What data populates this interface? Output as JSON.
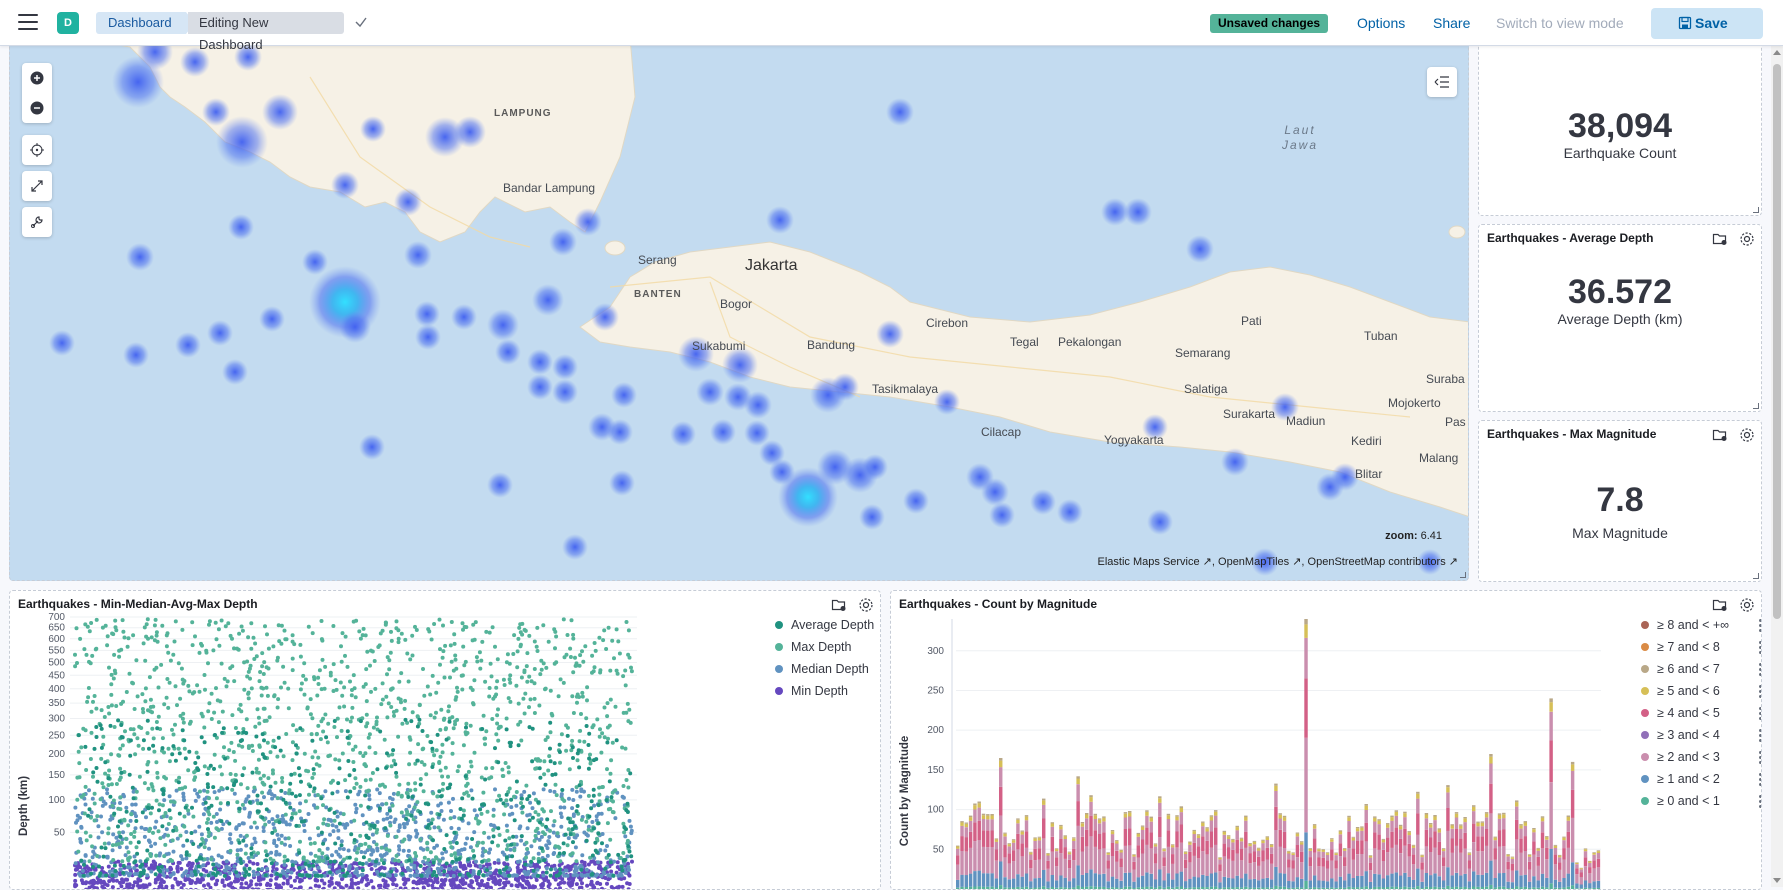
{
  "header": {
    "space_initial": "D",
    "breadcrumbs": [
      "Dashboard",
      "Editing New Dashboard"
    ],
    "unsaved_badge": "Unsaved changes",
    "options": "Options",
    "share": "Share",
    "switch_view": "Switch to view mode",
    "save": "Save"
  },
  "map": {
    "zoom_label": "zoom:",
    "zoom_value": "6.41",
    "attribution": [
      "Elastic Maps Service",
      "OpenMapTiles",
      "OpenStreetMap contributors"
    ],
    "labels": {
      "lampung": "LAMPUNG",
      "bandar_lampung": "Bandar Lampung",
      "laut_jawa": "Laut\nJawa",
      "serang": "Serang",
      "jakarta": "Jakarta",
      "banten": "BANTEN",
      "bogor": "Bogor",
      "cirebon": "Cirebon",
      "tegal": "Tegal",
      "pekalongan": "Pekalongan",
      "semarang": "Semarang",
      "pati": "Pati",
      "tuban": "Tuban",
      "surabaya": "Suraba",
      "sukabumi": "Sukabumi",
      "bandung": "Bandung",
      "tasikmalaya": "Tasikmalaya",
      "salatiga": "Salatiga",
      "mojokerto": "Mojokerto",
      "surakarta": "Surakarta",
      "madiun": "Madiun",
      "pasuruan": "Pas",
      "cilacap": "Cilacap",
      "yogyakarta": "Yogyakarta",
      "kediri": "Kediri",
      "blitar": "Blitar",
      "malang": "Malang"
    }
  },
  "metrics": [
    {
      "title": "",
      "value": "38,094",
      "label": "Earthquake Count"
    },
    {
      "title": "Earthquakes - Average Depth",
      "value": "36.572",
      "label": "Average Depth (km)"
    },
    {
      "title": "Earthquakes - Max Magnitude",
      "value": "7.8",
      "label": "Max Magnitude"
    }
  ],
  "depth_chart": {
    "title": "Earthquakes - Min-Median-Avg-Max Depth",
    "ylabel": "Depth (km)",
    "legend": [
      {
        "name": "Average Depth",
        "color": "#209280"
      },
      {
        "name": "Max Depth",
        "color": "#54b399"
      },
      {
        "name": "Median Depth",
        "color": "#6092c0"
      },
      {
        "name": "Min Depth",
        "color": "#6548bf"
      }
    ]
  },
  "magnitude_chart": {
    "title": "Earthquakes - Count by Magnitude",
    "ylabel": "Count by Magnitude",
    "legend": [
      {
        "name": "≥ 8 and < +∞",
        "color": "#aa6556"
      },
      {
        "name": "≥ 7 and < 8",
        "color": "#da8b45"
      },
      {
        "name": "≥ 6 and < 7",
        "color": "#b9a888"
      },
      {
        "name": "≥ 5 and < 6",
        "color": "#d6bf57"
      },
      {
        "name": "≥ 4 and < 5",
        "color": "#d36086"
      },
      {
        "name": "≥ 3 and < 4",
        "color": "#9170b8"
      },
      {
        "name": "≥ 2 and < 3",
        "color": "#ca8eae"
      },
      {
        "name": "≥ 1 and < 2",
        "color": "#6092c0"
      },
      {
        "name": "≥ 0 and < 1",
        "color": "#54b399"
      }
    ]
  },
  "chart_data": [
    {
      "type": "scatter",
      "title": "Earthquakes - Min-Median-Avg-Max Depth",
      "ylabel": "Depth (km)",
      "yscale": "sqrt",
      "yticks": [
        50,
        100,
        150,
        200,
        250,
        300,
        350,
        400,
        450,
        500,
        550,
        600,
        650,
        700
      ],
      "ylim": [
        0,
        700
      ],
      "legend_position": "right",
      "series": [
        {
          "name": "Max Depth",
          "range": [
            20,
            690
          ]
        },
        {
          "name": "Average Depth",
          "range": [
            10,
            500
          ]
        },
        {
          "name": "Median Depth",
          "range": [
            10,
            450
          ]
        },
        {
          "name": "Min Depth",
          "range": [
            1,
            60
          ]
        }
      ]
    },
    {
      "type": "bar",
      "stacked": true,
      "title": "Earthquakes - Count by Magnitude",
      "ylabel": "Count by Magnitude",
      "yticks": [
        50,
        100,
        150,
        200,
        250,
        300
      ],
      "ylim": [
        0,
        340
      ],
      "legend_position": "right",
      "peaks": [
        340,
        240,
        170,
        165,
        160
      ],
      "series": [
        "≥ 8 and < +∞",
        "≥ 7 and < 8",
        "≥ 6 and < 7",
        "≥ 5 and < 6",
        "≥ 4 and < 5",
        "≥ 3 and < 4",
        "≥ 2 and < 3",
        "≥ 1 and < 2",
        "≥ 0 and < 1"
      ]
    }
  ]
}
